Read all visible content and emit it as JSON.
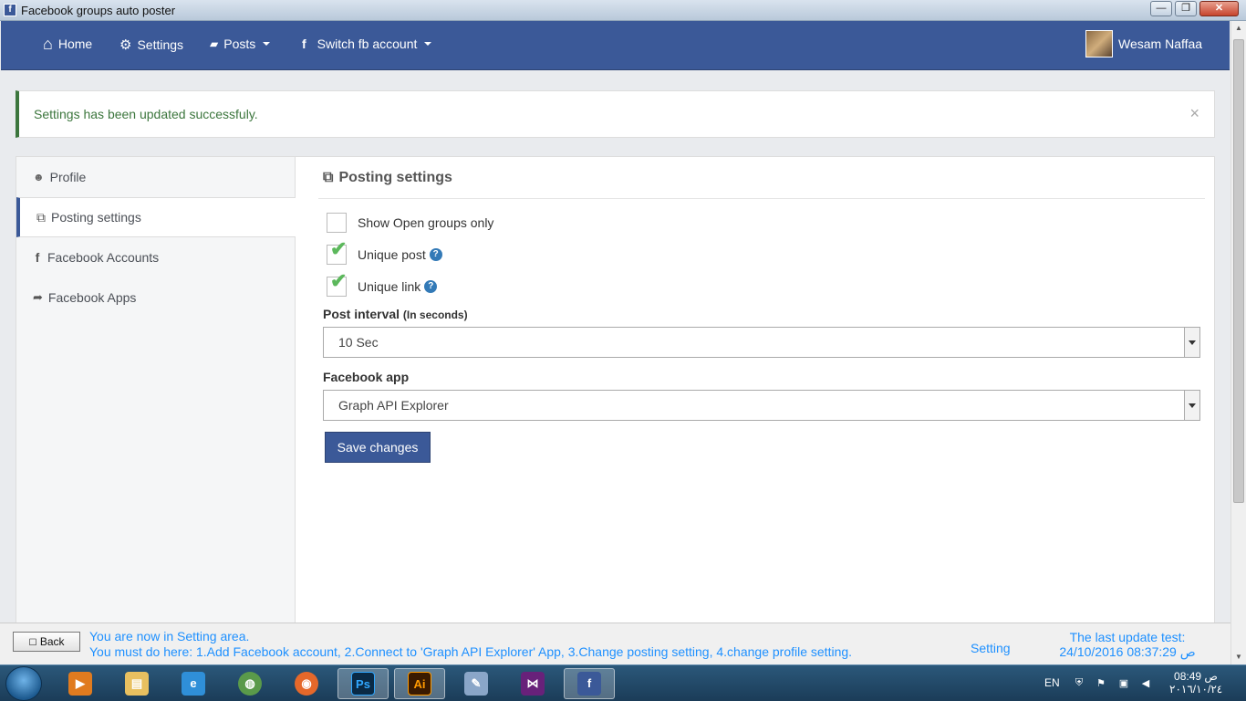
{
  "window": {
    "title": "Facebook groups auto poster",
    "icon": "app-icon",
    "controls": {
      "minimize": "—",
      "maximize": "❐",
      "close": "✕"
    }
  },
  "navbar": {
    "items": [
      {
        "label": "Home",
        "icon": "home-icon",
        "glyph": "⌂"
      },
      {
        "label": "Settings",
        "icon": "gear-icon",
        "glyph": "⚙"
      },
      {
        "label": "Posts",
        "icon": "folder-icon",
        "glyph": "▰",
        "dropdown": true
      },
      {
        "label": "Switch fb account",
        "icon": "facebook-icon",
        "glyph": "f",
        "dropdown": true
      }
    ],
    "user": {
      "name": "Wesam Naffaa"
    }
  },
  "alert": {
    "message": "Settings has been updated successfuly.",
    "close": "×",
    "color": "#3c763d"
  },
  "sidebar": {
    "items": [
      {
        "label": "Profile",
        "icon": "user-icon",
        "glyph": "👤",
        "active": false
      },
      {
        "label": "Posting settings",
        "icon": "copy-icon",
        "glyph": "⧉",
        "active": true
      },
      {
        "label": "Facebook Accounts",
        "icon": "facebook-icon",
        "glyph": "f",
        "active": false
      },
      {
        "label": "Facebook Apps",
        "icon": "plug-icon",
        "glyph": "🔌",
        "active": false
      }
    ]
  },
  "content": {
    "heading": "Posting settings",
    "heading_icon": "copy-icon",
    "checkboxes": [
      {
        "label": "Show Open groups only",
        "checked": false,
        "help": false
      },
      {
        "label": "Unique post",
        "checked": true,
        "help": true
      },
      {
        "label": "Unique link",
        "checked": true,
        "help": true
      }
    ],
    "post_interval": {
      "label": "Post interval",
      "hint": "(In seconds)",
      "value": "10 Sec"
    },
    "facebook_app": {
      "label": "Facebook app",
      "value": "Graph API Explorer"
    },
    "save_label": "Save changes"
  },
  "statusbar": {
    "back_label": "Back",
    "line1": "You are now in Setting area.",
    "line2": "You must do here: 1.Add Facebook account, 2.Connect to 'Graph API Explorer' App, 3.Change posting setting, 4.change profile setting.",
    "area": "Setting",
    "last_update_label": "The last update test:",
    "last_update_value": "24/10/2016 08:37:29 ص"
  },
  "taskbar": {
    "apps": [
      "media-player-icon",
      "explorer-icon",
      "ie-icon",
      "globe-icon",
      "firefox-icon",
      "photoshop-icon",
      "illustrator-icon",
      "pen-tool-icon",
      "visual-studio-icon",
      "fb-poster-icon"
    ],
    "active_app": "fb-poster-icon",
    "language": "EN",
    "time": "08:49 ص",
    "date": "٢٠١٦/١٠/٢٤"
  },
  "colors": {
    "brand": "#3b5998",
    "success": "#3c763d",
    "status_text": "#1e90ff",
    "check": "#5cb85c"
  }
}
